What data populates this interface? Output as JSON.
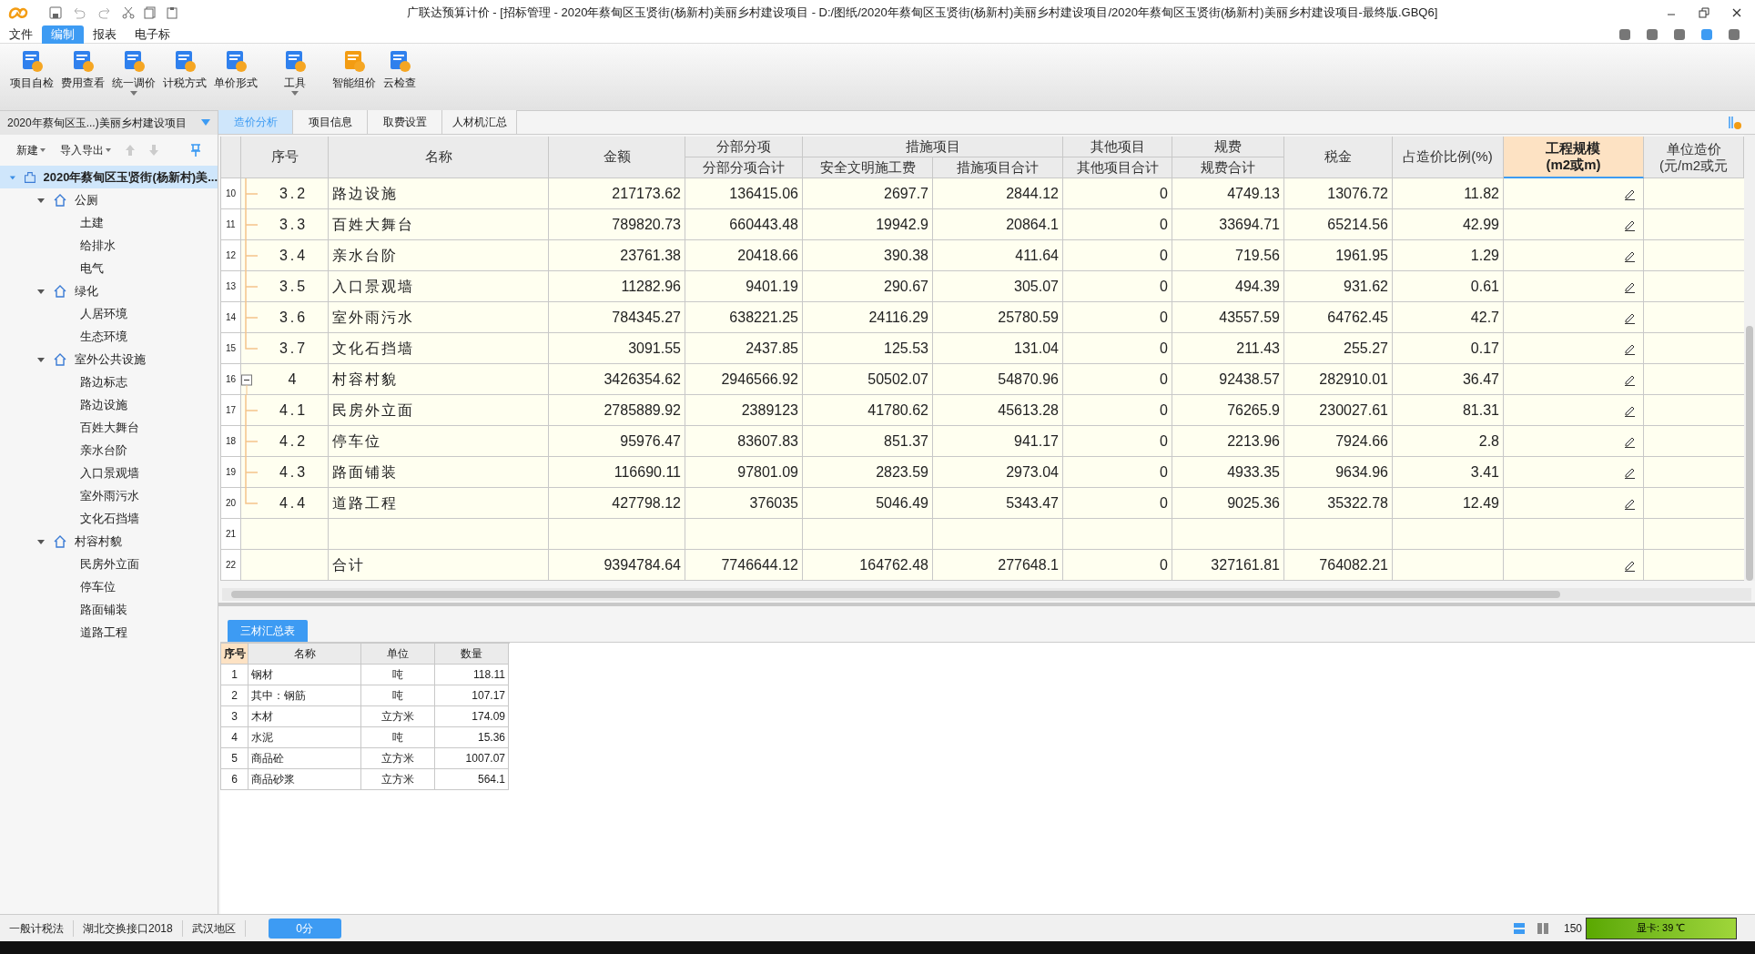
{
  "window": {
    "title": "广联达预算计价 - [招标管理 - 2020年蔡甸区玉贤街(杨新村)美丽乡村建设项目 - D:/图纸/2020年蔡甸区玉贤街(杨新村)美丽乡村建设项目/2020年蔡甸区玉贤街(杨新村)美丽乡村建设项目-最终版.GBQ6]"
  },
  "menu": [
    {
      "label": "文件",
      "selected": false
    },
    {
      "label": "编制",
      "selected": true
    },
    {
      "label": "报表",
      "selected": false
    },
    {
      "label": "电子标",
      "selected": false
    }
  ],
  "toolbar": [
    {
      "label": "项目自检",
      "kind": "check",
      "dropdown": false
    },
    {
      "label": "费用查看",
      "kind": "fee",
      "dropdown": false
    },
    {
      "label": "统一调价",
      "kind": "price",
      "dropdown": true
    },
    {
      "label": "计税方式",
      "kind": "tax",
      "dropdown": false
    },
    {
      "label": "单价形式",
      "kind": "unit",
      "dropdown": false
    },
    {
      "label": "工具",
      "kind": "tool",
      "dropdown": true
    },
    {
      "label": "智能组价",
      "kind": "smart",
      "dropdown": false
    },
    {
      "label": "云检查",
      "kind": "cloud",
      "dropdown": false
    }
  ],
  "project_selector": "2020年蔡甸区玉...)美丽乡村建设项目",
  "tabs": [
    {
      "label": "造价分析",
      "selected": true
    },
    {
      "label": "项目信息",
      "selected": false
    },
    {
      "label": "取费设置",
      "selected": false
    },
    {
      "label": "人材机汇总",
      "selected": false
    }
  ],
  "sidebar": {
    "actions": [
      "新建",
      "导入导出"
    ],
    "tree": [
      {
        "label": "2020年蔡甸区玉贤街(杨新村)美...",
        "selected": true,
        "expanded": true,
        "children": [
          {
            "label": "公厕",
            "selected": false,
            "expanded": true,
            "children": [
              {
                "label": "土建",
                "selected": false
              },
              {
                "label": "给排水",
                "selected": false
              },
              {
                "label": "电气",
                "selected": false
              }
            ]
          },
          {
            "label": "绿化",
            "selected": false,
            "expanded": true,
            "children": [
              {
                "label": "人居环境",
                "selected": false
              },
              {
                "label": "生态环境",
                "selected": false
              }
            ]
          },
          {
            "label": "室外公共设施",
            "selected": false,
            "expanded": true,
            "children": [
              {
                "label": "路边标志",
                "selected": false
              },
              {
                "label": "路边设施",
                "selected": false
              },
              {
                "label": "百姓大舞台",
                "selected": false
              },
              {
                "label": "亲水台阶",
                "selected": false
              },
              {
                "label": "入口景观墙",
                "selected": false
              },
              {
                "label": "室外雨污水",
                "selected": false
              },
              {
                "label": "文化石挡墙",
                "selected": false
              }
            ]
          },
          {
            "label": "村容村貌",
            "selected": false,
            "expanded": true,
            "children": [
              {
                "label": "民房外立面",
                "selected": false
              },
              {
                "label": "停车位",
                "selected": false
              },
              {
                "label": "路面铺装",
                "selected": false
              },
              {
                "label": "道路工程",
                "selected": false
              }
            ]
          }
        ]
      }
    ]
  },
  "table": {
    "header_groups": [
      "分部分项",
      "措施项目",
      "其他项目",
      "规费"
    ],
    "columns": [
      "序号",
      "名称",
      "金额",
      "分部分项合计",
      "安全文明施工费",
      "措施项目合计",
      "其他项目合计",
      "规费合计",
      "税金",
      "占造价比例(%)",
      "工程规模\n(m2或m)",
      "单位造价\n(元/m2或元"
    ],
    "rows": [
      {
        "num": "10",
        "kind": "branch",
        "cells": [
          "3.2",
          "路边设施",
          "217173.62",
          "136415.06",
          "2697.7",
          "2844.12",
          "0",
          "4749.13",
          "13076.72",
          "11.82"
        ],
        "editable": true
      },
      {
        "num": "11",
        "kind": "branch",
        "cells": [
          "3.3",
          "百姓大舞台",
          "789820.73",
          "660443.48",
          "19942.9",
          "20864.1",
          "0",
          "33694.71",
          "65214.56",
          "42.99"
        ],
        "editable": true
      },
      {
        "num": "12",
        "kind": "branch",
        "cells": [
          "3.4",
          "亲水台阶",
          "23761.38",
          "20418.66",
          "390.38",
          "411.64",
          "0",
          "719.56",
          "1961.95",
          "1.29"
        ],
        "editable": true
      },
      {
        "num": "13",
        "kind": "branch",
        "cells": [
          "3.5",
          "入口景观墙",
          "11282.96",
          "9401.19",
          "290.67",
          "305.07",
          "0",
          "494.39",
          "931.62",
          "0.61"
        ],
        "editable": true
      },
      {
        "num": "14",
        "kind": "branch",
        "cells": [
          "3.6",
          "室外雨污水",
          "784345.27",
          "638221.25",
          "24116.29",
          "25780.59",
          "0",
          "43557.59",
          "64762.45",
          "42.7"
        ],
        "editable": true
      },
      {
        "num": "15",
        "kind": "last",
        "cells": [
          "3.7",
          "文化石挡墙",
          "3091.55",
          "2437.85",
          "125.53",
          "131.04",
          "0",
          "211.43",
          "255.27",
          "0.17"
        ],
        "editable": true
      },
      {
        "num": "16",
        "kind": "collapse",
        "cells": [
          "4",
          "村容村貌",
          "3426354.62",
          "2946566.92",
          "50502.07",
          "54870.96",
          "0",
          "92438.57",
          "282910.01",
          "36.47"
        ],
        "editable": true
      },
      {
        "num": "17",
        "kind": "branch",
        "cells": [
          "4.1",
          "民房外立面",
          "2785889.92",
          "2389123",
          "41780.62",
          "45613.28",
          "0",
          "76265.9",
          "230027.61",
          "81.31"
        ],
        "editable": true
      },
      {
        "num": "18",
        "kind": "branch",
        "cells": [
          "4.2",
          "停车位",
          "95976.47",
          "83607.83",
          "851.37",
          "941.17",
          "0",
          "2213.96",
          "7924.66",
          "2.8"
        ],
        "editable": true
      },
      {
        "num": "19",
        "kind": "branch",
        "cells": [
          "4.3",
          "路面铺装",
          "116690.11",
          "97801.09",
          "2823.59",
          "2973.04",
          "0",
          "4933.35",
          "9634.96",
          "3.41"
        ],
        "editable": true
      },
      {
        "num": "20",
        "kind": "last",
        "cells": [
          "4.4",
          "道路工程",
          "427798.12",
          "376035",
          "5046.49",
          "5343.47",
          "0",
          "9025.36",
          "35322.78",
          "12.49"
        ],
        "editable": true
      },
      {
        "num": "21",
        "kind": "none",
        "cells": [
          "",
          "",
          "",
          "",
          "",
          "",
          "",
          "",
          "",
          ""
        ],
        "editable": false
      },
      {
        "num": "22",
        "kind": "none",
        "cells": [
          "",
          "合计",
          "9394784.64",
          "7746644.12",
          "164762.48",
          "277648.1",
          "0",
          "327161.81",
          "764082.21",
          ""
        ],
        "editable": true
      }
    ]
  },
  "materials": {
    "tab": "三材汇总表",
    "columns": [
      "序号",
      "名称",
      "单位",
      "数量"
    ],
    "rows": [
      [
        "1",
        "钢材",
        "吨",
        "118.11"
      ],
      [
        "2",
        "其中：钢筋",
        "吨",
        "107.17"
      ],
      [
        "3",
        "木材",
        "立方米",
        "174.09"
      ],
      [
        "4",
        "水泥",
        "吨",
        "15.36"
      ],
      [
        "5",
        "商品砼",
        "立方米",
        "1007.07"
      ],
      [
        "6",
        "商品砂浆",
        "立方米",
        "564.1"
      ]
    ]
  },
  "status_bar": {
    "items": [
      "一般计税法",
      "湖北交换接口2018",
      "武汉地区"
    ],
    "button": "0分",
    "zoom": "150",
    "gpu": "显卡: 39 ℃"
  }
}
